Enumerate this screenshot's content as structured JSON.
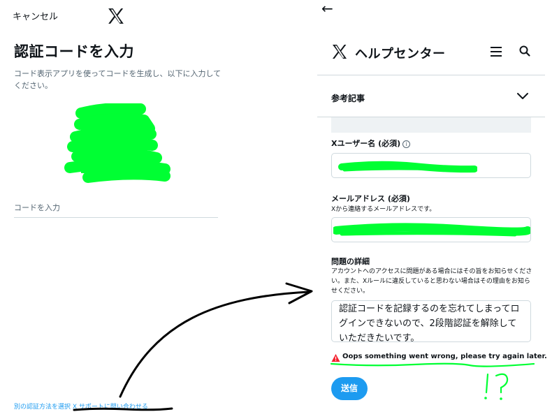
{
  "left_panel": {
    "cancel_label": "キャンセル",
    "title": "認証コードを入力",
    "description": "コード表示アプリを使ってコードを生成し、以下に入力してください。",
    "code_placeholder": "コードを入力",
    "bottom_link": "別の認証方法を選択 X サポートに問い合わせる"
  },
  "right_panel": {
    "back_arrow": "←",
    "header_title": "ヘルプセンター",
    "related_articles_label": "参考記事",
    "username_label": "Xユーザー名 (必須)",
    "info_glyph": "i",
    "email_label": "メールアドレス (必須)",
    "email_sublabel": "Xから連絡するメールアドレスです。",
    "details_label": "問題の詳細",
    "details_description": "アカウントへのアクセスに問題がある場合にはその旨をお知らせください。また、Xルールに違反していると思わない場合はその理由をお知らせください。",
    "details_value": "認証コードを記録するのを忘れてしまってログインできないので、2段階認証を解除していただきたいです。",
    "error_message": "Oops something went wrong, please try again later.",
    "submit_label": "送信"
  },
  "icons": {
    "logo": "x-logo-icon",
    "menu": "hamburger-menu-icon",
    "search": "search-icon",
    "expand": "chevron-down-icon",
    "info": "info-icon",
    "warning": "warning-icon",
    "back": "back-arrow-icon"
  },
  "colors": {
    "accent": "#1d9bf0",
    "redaction": "#00ff33",
    "error_red": "#f4212e",
    "annotation": "#000000"
  }
}
